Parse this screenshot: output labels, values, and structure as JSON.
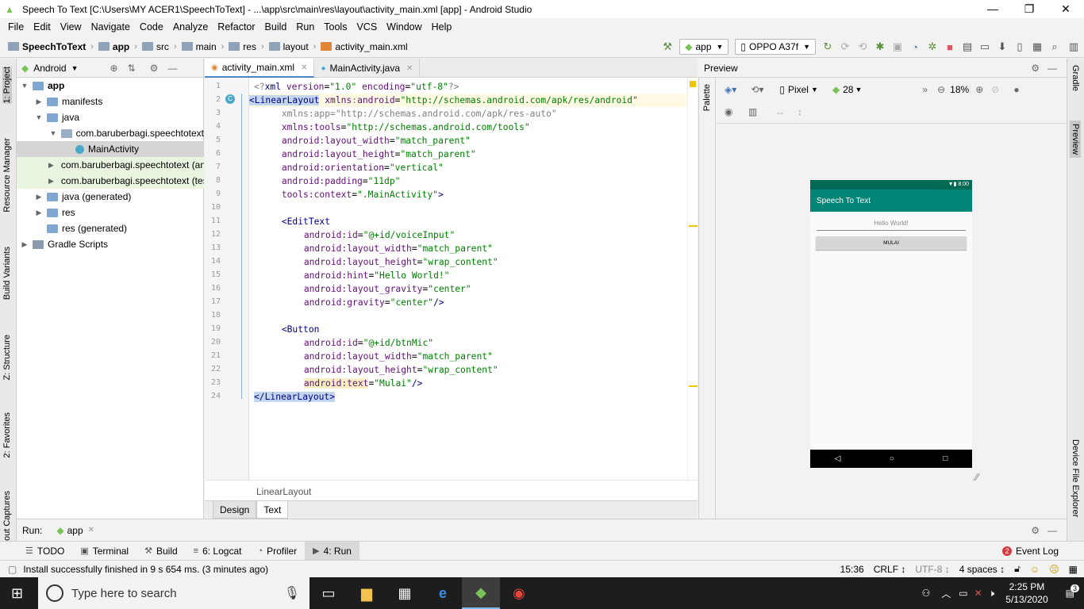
{
  "window": {
    "title": "Speech To Text [C:\\Users\\MY ACER1\\SpeechToText] - ...\\app\\src\\main\\res\\layout\\activity_main.xml [app] - Android Studio",
    "minimize": "—",
    "maximize": "❐",
    "close": "✕"
  },
  "menu": [
    "File",
    "Edit",
    "View",
    "Navigate",
    "Code",
    "Analyze",
    "Refactor",
    "Build",
    "Run",
    "Tools",
    "VCS",
    "Window",
    "Help"
  ],
  "breadcrumb": [
    "SpeechToText",
    "app",
    "src",
    "main",
    "res",
    "layout",
    "activity_main.xml"
  ],
  "toolbar": {
    "run_config": "app",
    "device": "OPPO A37f"
  },
  "left_stripe": [
    "1: Project",
    "Resource Manager",
    "Build Variants",
    "Z: Structure",
    "2: Favorites",
    "Layout Captures"
  ],
  "project": {
    "view": "Android",
    "tree": [
      {
        "label": "app",
        "indent": 0,
        "arrow": "▼",
        "icon": "folder",
        "bold": true
      },
      {
        "label": "manifests",
        "indent": 1,
        "arrow": "▶",
        "icon": "folder"
      },
      {
        "label": "java",
        "indent": 1,
        "arrow": "▼",
        "icon": "folder"
      },
      {
        "label": "com.baruberbagi.speechtotext",
        "indent": 2,
        "arrow": "▼",
        "icon": "package"
      },
      {
        "label": "MainActivity",
        "indent": 3,
        "arrow": "",
        "icon": "class",
        "selected": true
      },
      {
        "label": "com.baruberbagi.speechtotext (androidTest)",
        "indent": 2,
        "arrow": "▶",
        "icon": "package",
        "green": true
      },
      {
        "label": "com.baruberbagi.speechtotext (test)",
        "indent": 2,
        "arrow": "▶",
        "icon": "package",
        "green": true
      },
      {
        "label": "java (generated)",
        "indent": 1,
        "arrow": "▶",
        "icon": "folder"
      },
      {
        "label": "res",
        "indent": 1,
        "arrow": "▶",
        "icon": "folder"
      },
      {
        "label": "res (generated)",
        "indent": 1,
        "arrow": "",
        "icon": "folder"
      },
      {
        "label": "Gradle Scripts",
        "indent": 0,
        "arrow": "▶",
        "icon": "gradle"
      }
    ]
  },
  "editor": {
    "tabs": [
      {
        "label": "activity_main.xml",
        "active": true
      },
      {
        "label": "MainActivity.java",
        "active": false
      }
    ],
    "lines": [
      [
        [
          "ns",
          "<?"
        ],
        [
          "tag",
          "xml "
        ],
        [
          "attr",
          "version"
        ],
        [
          "",
          "="
        ],
        [
          "val",
          "\"1.0\" "
        ],
        [
          "attr",
          "encoding"
        ],
        [
          "",
          "="
        ],
        [
          "val",
          "\"utf-8\""
        ],
        [
          "ns",
          "?>"
        ]
      ],
      [
        [
          "sel tag",
          "<LinearLayout"
        ],
        [
          "",
          " "
        ],
        [
          "attr",
          "xmlns"
        ],
        [
          "ns",
          ":"
        ],
        [
          "attr",
          "android"
        ],
        [
          "",
          "="
        ],
        [
          "val",
          "\"http://schemas.android.com/apk/res/android\""
        ]
      ],
      [
        [
          "",
          " "
        ],
        [
          "ns",
          "xmlns:app=\"http://schemas.android.com/apk/res-auto\""
        ]
      ],
      [
        [
          "",
          " "
        ],
        [
          "attr",
          "xmlns:tools"
        ],
        [
          "",
          "="
        ],
        [
          "val",
          "\"http://schemas.android.com/tools\""
        ]
      ],
      [
        [
          "",
          " "
        ],
        [
          "attr",
          "android:layout_width"
        ],
        [
          "",
          "="
        ],
        [
          "val",
          "\"match_parent\""
        ]
      ],
      [
        [
          "",
          " "
        ],
        [
          "attr",
          "android:layout_height"
        ],
        [
          "",
          "="
        ],
        [
          "val",
          "\"match_parent\""
        ]
      ],
      [
        [
          "",
          " "
        ],
        [
          "attr",
          "android:orientation"
        ],
        [
          "",
          "="
        ],
        [
          "val",
          "\"vertical\""
        ]
      ],
      [
        [
          "",
          " "
        ],
        [
          "attr",
          "android:padding"
        ],
        [
          "",
          "="
        ],
        [
          "val",
          "\"11dp\""
        ]
      ],
      [
        [
          "",
          " "
        ],
        [
          "attr",
          "tools:context"
        ],
        [
          "",
          "="
        ],
        [
          "val",
          "\".MainActivity\""
        ],
        [
          "tag",
          ">"
        ]
      ],
      [
        [
          "",
          ""
        ]
      ],
      [
        [
          "",
          " "
        ],
        [
          "tag",
          "<EditText"
        ]
      ],
      [
        [
          "",
          " "
        ],
        [
          "attr",
          "android:id"
        ],
        [
          "",
          "="
        ],
        [
          "val",
          "\"@+id/voiceInput\""
        ]
      ],
      [
        [
          "",
          " "
        ],
        [
          "attr",
          "android:layout_width"
        ],
        [
          "",
          "="
        ],
        [
          "val",
          "\"match_parent\""
        ]
      ],
      [
        [
          "",
          " "
        ],
        [
          "attr",
          "android:layout_height"
        ],
        [
          "",
          "="
        ],
        [
          "val",
          "\"wrap_content\""
        ]
      ],
      [
        [
          "",
          " "
        ],
        [
          "attr",
          "android:hint"
        ],
        [
          "",
          "="
        ],
        [
          "val",
          "\"Hello World!\""
        ]
      ],
      [
        [
          "",
          " "
        ],
        [
          "attr",
          "android:layout_gravity"
        ],
        [
          "",
          "="
        ],
        [
          "val",
          "\"center\""
        ]
      ],
      [
        [
          "",
          " "
        ],
        [
          "attr",
          "android:gravity"
        ],
        [
          "",
          "="
        ],
        [
          "val",
          "\"center\""
        ],
        [
          "tag",
          "/>"
        ]
      ],
      [
        [
          "",
          ""
        ]
      ],
      [
        [
          "",
          " "
        ],
        [
          "tag",
          "<Button"
        ]
      ],
      [
        [
          "",
          " "
        ],
        [
          "attr",
          "android:id"
        ],
        [
          "",
          "="
        ],
        [
          "val",
          "\"@+id/btnMic\""
        ]
      ],
      [
        [
          "",
          " "
        ],
        [
          "attr",
          "android:layout_width"
        ],
        [
          "",
          "="
        ],
        [
          "val",
          "\"match_parent\""
        ]
      ],
      [
        [
          "",
          " "
        ],
        [
          "attr",
          "android:layout_height"
        ],
        [
          "",
          "="
        ],
        [
          "val",
          "\"wrap_content\""
        ]
      ],
      [
        [
          "",
          " "
        ],
        [
          "attr",
          "android:text"
        ],
        [
          "",
          "="
        ],
        [
          "val",
          "\"Mulai\""
        ],
        [
          "tag",
          "/>"
        ]
      ],
      [
        [
          "sel tag",
          "</LinearLayout>"
        ]
      ]
    ],
    "indents": [
      0,
      0,
      1,
      1,
      1,
      1,
      1,
      1,
      1,
      0,
      1,
      2,
      2,
      2,
      2,
      2,
      2,
      0,
      1,
      2,
      2,
      2,
      2,
      0
    ],
    "footer": "LinearLayout",
    "design_tabs": [
      "Design",
      "Text"
    ]
  },
  "preview": {
    "title": "Preview",
    "palette": "Palette",
    "device": "Pixel",
    "api": "28",
    "zoom": "18%",
    "phone": {
      "time": "8:00",
      "app_title": "Speech To Text",
      "hint": "Hello World!",
      "button": "MULAI",
      "nav": [
        "◁",
        "○",
        "□"
      ]
    }
  },
  "right_stripe": [
    "Gradle",
    "Preview",
    "Device File Explorer"
  ],
  "run": {
    "label": "Run:",
    "config": "app"
  },
  "bottom_tools": [
    {
      "icon": "☰",
      "label": "TODO"
    },
    {
      "icon": "▣",
      "label": "Terminal"
    },
    {
      "icon": "⚒",
      "label": "Build"
    },
    {
      "icon": "≡",
      "label": "6: Logcat"
    },
    {
      "icon": "◔",
      "label": "Profiler"
    },
    {
      "icon": "▶",
      "label": "4: Run",
      "active": true
    }
  ],
  "event_log": {
    "count": "2",
    "label": "Event Log"
  },
  "status": {
    "message": "Install successfully finished in 9 s 654 ms. (3 minutes ago)",
    "position": "15:36",
    "line_sep": "CRLF ↕",
    "encoding": "UTF-8 ↕",
    "indent": "4 spaces ↕"
  },
  "taskbar": {
    "search_placeholder": "Type here to search",
    "time": "2:25 PM",
    "date": "5/13/2020",
    "notifications": "3"
  }
}
